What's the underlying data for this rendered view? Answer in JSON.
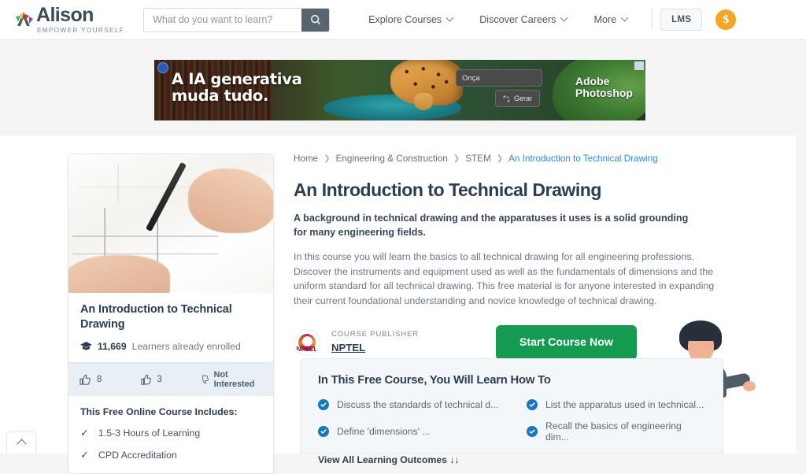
{
  "header": {
    "logo_name": "Alison",
    "logo_tagline": "EMPOWER YOURSELF",
    "search": {
      "value": "",
      "placeholder": "What do you want to learn?",
      "icon": "search-icon"
    },
    "nav": [
      {
        "label": "Explore Courses",
        "icon": "chevron-down-icon"
      },
      {
        "label": "Discover Careers",
        "icon": "chevron-down-icon"
      },
      {
        "label": "More",
        "icon": "chevron-down-icon"
      }
    ],
    "lms_label": "LMS",
    "coin_symbol": "$",
    "coin_color": "#f5a623"
  },
  "ad": {
    "headline_line1": "A IA generativa",
    "headline_line2": "muda tudo.",
    "prompt_value": "Onça",
    "generate_label": "Gerar",
    "brand_line1": "Adobe",
    "brand_line2": "Photoshop",
    "badge_icon": "info-badge-icon",
    "adchoices_icon": "adchoices-icon"
  },
  "breadcrumb": [
    {
      "label": "Home",
      "current": false
    },
    {
      "label": "Engineering & Construction",
      "current": false
    },
    {
      "label": "STEM",
      "current": false
    },
    {
      "label": "An Introduction to Technical Drawing",
      "current": true
    }
  ],
  "course": {
    "title": "An Introduction to Technical Drawing",
    "lede": "A background in technical drawing and the apparatuses it uses is a solid grounding for many engineering fields.",
    "description": "In this course you will learn the basics to all technical drawing for all engineering professions. Discover the instruments and equipment used as well as the fundamentals of dimensions and the uniform standard for all technical drawing. This free material is for anyone interested in expanding their current foundational understanding and novice knowledge of technical drawing.",
    "publisher_label": "COURSE PUBLISHER",
    "publisher_name": "NPTEL",
    "publisher_logo_text": "NPTEL",
    "cta_label": "Start Course Now",
    "cta_color": "#159a52"
  },
  "card": {
    "thumbnail_alt": "hand drawing technical blueprint with pen",
    "title": "An Introduction to Technical Drawing",
    "enrolled_count": "11,669",
    "enrolled_label": "Learners already enrolled",
    "enrolled_icon": "graduation-cap-icon",
    "actions": [
      {
        "icon": "thumbs-up-double-icon",
        "label": "8"
      },
      {
        "icon": "thumbs-up-icon",
        "label": "3"
      },
      {
        "icon": "thumbs-down-icon",
        "label": "Not Interested"
      }
    ],
    "includes_title": "This Free Online Course Includes:",
    "includes": [
      {
        "icon": "check-icon",
        "label": "1.5-3 Hours of Learning"
      },
      {
        "icon": "check-icon",
        "label": "CPD Accreditation"
      }
    ]
  },
  "learn": {
    "heading": "In This Free Course, You Will Learn How To",
    "outcomes": [
      "Discuss the standards of technical d...",
      "List the apparatus used in technical...",
      "Define 'dimensions' ...",
      "Recall the basics of engineering dim..."
    ],
    "view_all_label": "View All Learning Outcomes ↓↓",
    "check_color": "#1878bf"
  },
  "scroll_top": {
    "icon": "chevron-up-icon"
  }
}
